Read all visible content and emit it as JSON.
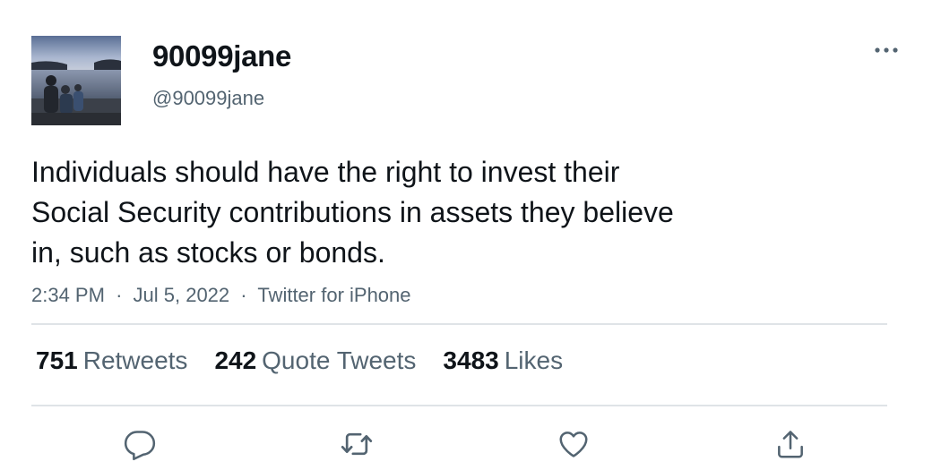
{
  "author": {
    "display_name": "90099jane",
    "handle": "@90099jane"
  },
  "tweet": {
    "text_lines": [
      "Individuals should have the right to invest their",
      "Social Security contributions in assets they believe",
      "in, such as stocks or bonds."
    ]
  },
  "meta": {
    "time": "2:34 PM",
    "separator": "·",
    "date": "Jul 5, 2022",
    "source": "Twitter for iPhone"
  },
  "stats": {
    "retweets": {
      "count": "751",
      "label": "Retweets"
    },
    "quotes": {
      "count": "242",
      "label": "Quote Tweets"
    },
    "likes": {
      "count": "3483",
      "label": "Likes"
    }
  },
  "icons": {
    "more": "more-horizontal-icon",
    "reply": "reply-icon",
    "retweet": "retweet-icon",
    "like": "heart-icon",
    "share": "share-icon"
  },
  "colors": {
    "text_primary": "#0f1419",
    "text_secondary": "#536471",
    "divider": "#dfe3e7"
  }
}
